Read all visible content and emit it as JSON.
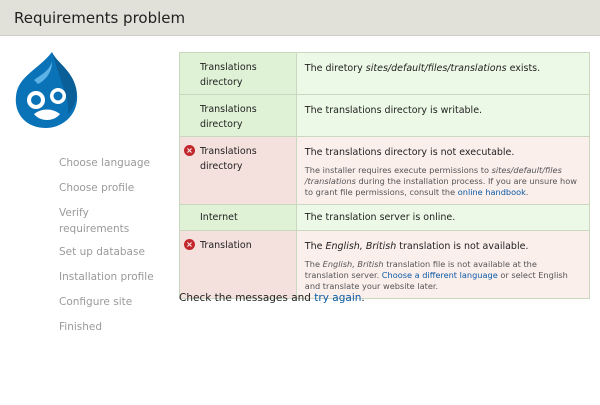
{
  "header": {
    "title": "Requirements problem"
  },
  "steps": [
    "Choose language",
    "Choose profile",
    "Verify requirements",
    "Set up database",
    "Installation profile",
    "Configure site",
    "Finished"
  ],
  "requirements": [
    {
      "status": "ok",
      "name": "Translations directory",
      "value_pre": "The diretory ",
      "value_em": "sites/default/files/translations",
      "value_post": " exists."
    },
    {
      "status": "ok",
      "name": "Translations directory",
      "value": "The translations directory is writable."
    },
    {
      "status": "error",
      "name": "Translations directory",
      "value": "The translations directory is not executable.",
      "desc_pre": "The installer requires execute permissions to ",
      "desc_em": "sites/default/files /translations",
      "desc_mid": " during the installation process. If you are unsure how to grant file permissions, consult the ",
      "desc_link": "online handbook",
      "desc_post": "."
    },
    {
      "status": "ok",
      "name": "Internet",
      "value": "The translation server is online."
    },
    {
      "status": "error",
      "name": "Translation",
      "value_pre": "The ",
      "value_em": "English, British",
      "value_post": " translation is not available.",
      "desc_pre": "The ",
      "desc_em": "English, British",
      "desc_mid": " translation file is not available at the translation server. ",
      "desc_link": "Choose a different language",
      "desc_post": " or select English and translate your website later."
    }
  ],
  "footer": {
    "text_pre": "Check the messages and ",
    "link": "try again",
    "text_post": "."
  },
  "colors": {
    "ok_bg": "#ecf9e6",
    "error_bg": "#fbefec",
    "error_icon": "#c1272d",
    "link": "#0b5aa6"
  },
  "icons": {
    "error": "error-icon",
    "logo": "drupal-logo"
  }
}
